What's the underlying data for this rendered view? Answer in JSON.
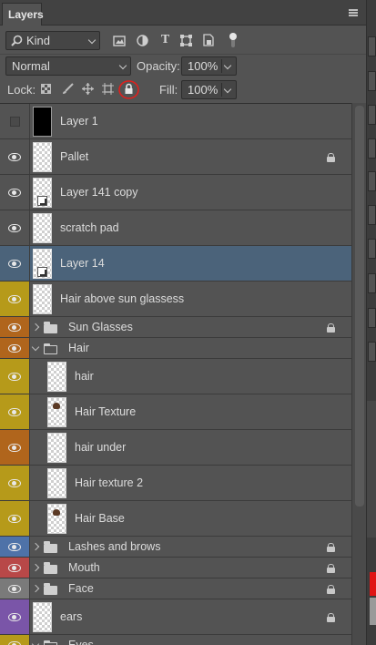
{
  "panel": {
    "tab_label": "Layers",
    "filter": {
      "kind_label": "Kind"
    },
    "blend_mode": "Normal",
    "opacity_label": "Opacity:",
    "opacity_value": "100%",
    "lock_label": "Lock:",
    "fill_label": "Fill:",
    "fill_value": "100%"
  },
  "layers": [
    {
      "name": "Layer 1",
      "type": "layer",
      "visible": false,
      "thumb": "black",
      "locked": false,
      "color": null
    },
    {
      "name": "Pallet",
      "type": "layer",
      "visible": true,
      "thumb": "transparent",
      "locked": true,
      "color": null
    },
    {
      "name": "Layer 141 copy",
      "type": "layer",
      "visible": true,
      "thumb": "smart",
      "locked": false,
      "color": null
    },
    {
      "name": "scratch pad",
      "type": "layer",
      "visible": true,
      "thumb": "transparent",
      "locked": false,
      "color": null
    },
    {
      "name": "Layer 14",
      "type": "layer",
      "visible": true,
      "thumb": "smart",
      "locked": false,
      "color": null,
      "selected": true
    },
    {
      "name": "Hair above sun glassess",
      "type": "layer",
      "visible": true,
      "thumb": "transparent",
      "locked": false,
      "color": "#b69a1a"
    },
    {
      "name": "Sun Glasses",
      "type": "group",
      "expanded": false,
      "visible": true,
      "locked": true,
      "color": "#b0651c"
    },
    {
      "name": "Hair",
      "type": "group",
      "expanded": true,
      "visible": true,
      "locked": false,
      "color": "#b0651c"
    },
    {
      "name": "hair",
      "type": "layer",
      "indent": true,
      "visible": true,
      "thumb": "transparent",
      "locked": false,
      "color": "#b69a1a"
    },
    {
      "name": "Hair Texture",
      "type": "layer",
      "indent": true,
      "visible": true,
      "thumb": "hair",
      "locked": false,
      "color": "#b69a1a"
    },
    {
      "name": "hair under",
      "type": "layer",
      "indent": true,
      "visible": true,
      "thumb": "transparent",
      "locked": false,
      "color": "#b0651c"
    },
    {
      "name": "Hair texture 2",
      "type": "layer",
      "indent": true,
      "visible": true,
      "thumb": "transparent",
      "locked": false,
      "color": "#b69a1a"
    },
    {
      "name": "Hair Base",
      "type": "layer",
      "indent": true,
      "visible": true,
      "thumb": "hair",
      "locked": false,
      "color": "#b69a1a"
    },
    {
      "name": "Lashes and brows",
      "type": "group",
      "expanded": false,
      "visible": true,
      "locked": true,
      "color": "#4e72a8"
    },
    {
      "name": "Mouth",
      "type": "group",
      "expanded": false,
      "visible": true,
      "locked": true,
      "color": "#b84848"
    },
    {
      "name": "Face",
      "type": "group",
      "expanded": false,
      "visible": true,
      "locked": true,
      "color": "#7a7a7a"
    },
    {
      "name": "ears",
      "type": "layer",
      "visible": true,
      "thumb": "transparent",
      "locked": true,
      "color": "#7a55a8"
    },
    {
      "name": "Eyes",
      "type": "group",
      "expanded": true,
      "visible": true,
      "locked": false,
      "color": "#b69a1a"
    }
  ],
  "colors": {
    "selection": "#4b637a",
    "highlight_circle": "#e0201d"
  }
}
